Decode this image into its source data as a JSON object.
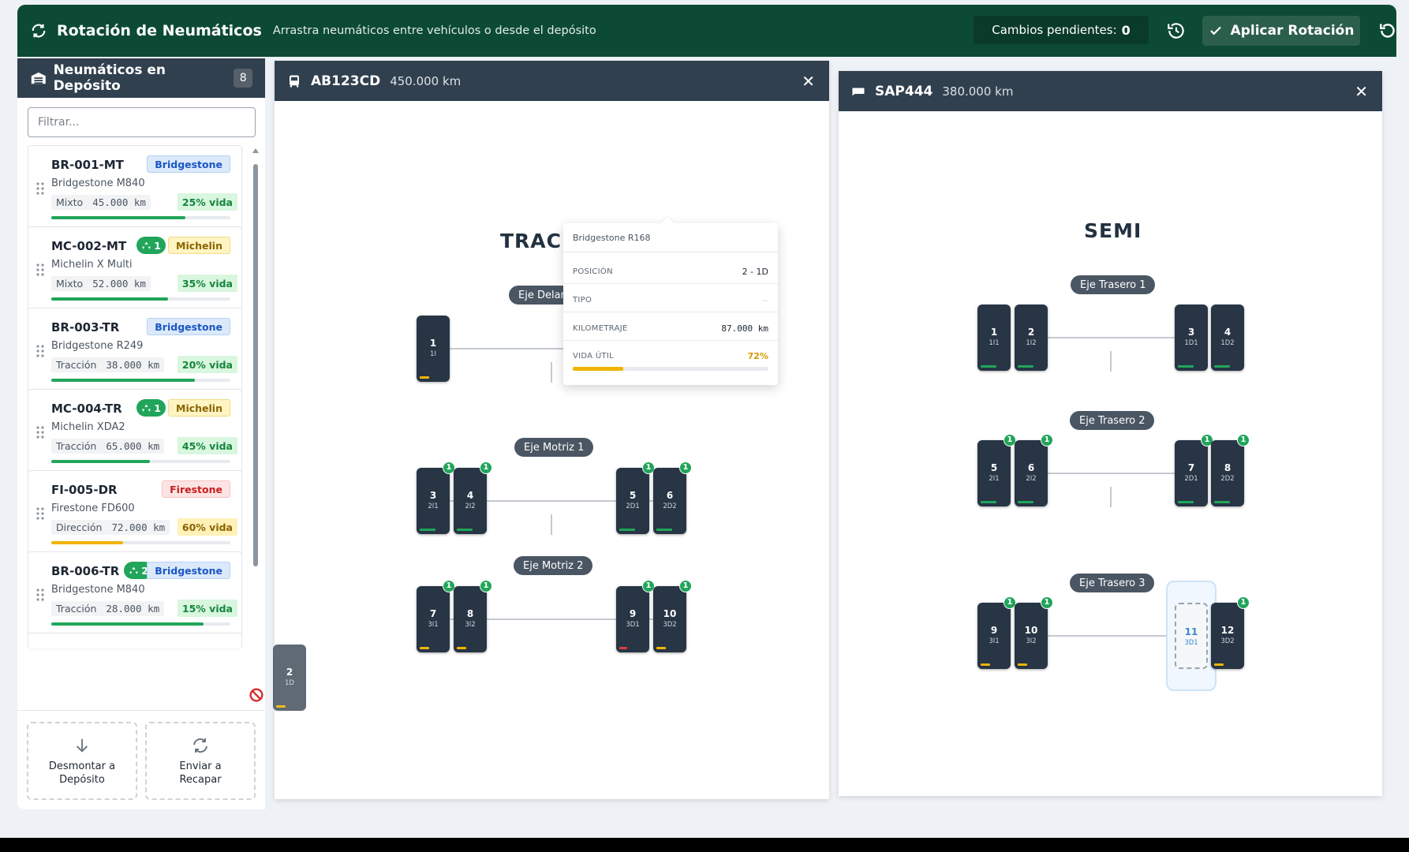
{
  "header": {
    "title": "Rotación de Neumáticos",
    "subtitle": "Arrastra neumáticos entre vehículos o desde el depósito",
    "pending_label": "Cambios pendientes:",
    "pending_count": "0",
    "apply_label": "Aplicar Rotación",
    "bg_color": "#0c4a35"
  },
  "sidebar": {
    "title": "Neumáticos en Depósito",
    "count": "8",
    "filter_placeholder": "Filtrar...",
    "cards": [
      {
        "code": "BR-001-MT",
        "brand": "Bridgestone",
        "model": "Bridgestone M840",
        "type": "Mixto",
        "km": "45.000 km",
        "life": "25% vida",
        "life_value": 0.75
      },
      {
        "code": "MC-002-MT",
        "recap": "1",
        "brand": "Michelin",
        "model": "Michelin X Multi",
        "type": "Mixto",
        "km": "52.000 km",
        "life": "35% vida",
        "life_value": 0.65
      },
      {
        "code": "BR-003-TR",
        "brand": "Bridgestone",
        "model": "Bridgestone R249",
        "type": "Tracción",
        "km": "38.000 km",
        "life": "20% vida",
        "life_value": 0.8
      },
      {
        "code": "MC-004-TR",
        "recap": "1",
        "brand": "Michelin",
        "model": "Michelin XDA2",
        "type": "Tracción",
        "km": "65.000 km",
        "life": "45% vida",
        "life_value": 0.55
      },
      {
        "code": "FI-005-DR",
        "brand": "Firestone",
        "model": "Firestone FD600",
        "type": "Dirección",
        "km": "72.000 km",
        "life": "60% vida",
        "life_value": 0.4
      },
      {
        "code": "BR-006-TR",
        "recap": "2",
        "brand": "Bridgestone",
        "model": "Bridgestone M840",
        "type": "Tracción",
        "km": "28.000 km",
        "life": "15% vida",
        "life_value": 0.85
      }
    ],
    "unmount_label_1": "Desmontar a",
    "unmount_label_2": "Depósito",
    "recap_label_1": "Enviar a",
    "recap_label_2": "Recapar"
  },
  "vehicle_a": {
    "plate": "AB123CD",
    "km": "450.000 km",
    "title": "TRAC",
    "axle_front": "Eje Delan",
    "axle_m1": "Eje Motriz 1",
    "axle_m2": "Eje Motriz 2",
    "tires": [
      {
        "n": "1",
        "p": "1I"
      },
      {
        "n": "3",
        "p": "2I1"
      },
      {
        "n": "4",
        "p": "2I2"
      },
      {
        "n": "5",
        "p": "2D1"
      },
      {
        "n": "6",
        "p": "2D2"
      },
      {
        "n": "7",
        "p": "3I1"
      },
      {
        "n": "8",
        "p": "3I2"
      },
      {
        "n": "9",
        "p": "3D1"
      },
      {
        "n": "10",
        "p": "3D2"
      }
    ],
    "badge": "1"
  },
  "dragged_tire": {
    "n": "2",
    "p": "1D"
  },
  "tooltip": {
    "model": "Bridgestone R168",
    "pos_label": "POSICIÓN",
    "pos_value": "2 - 1D",
    "type_label": "TIPO",
    "type_value": "--",
    "km_label": "KILOMETRAJE",
    "km_value": "87.000 km",
    "life_label": "VIDA ÚTIL",
    "life_value": "72%"
  },
  "vehicle_b": {
    "plate": "SAP444",
    "km": "380.000 km",
    "title": "SEMI",
    "axle_t1": "Eje Trasero 1",
    "axle_t2": "Eje Trasero 2",
    "axle_t3": "Eje Trasero 3",
    "tires": [
      {
        "n": "1",
        "p": "1I1"
      },
      {
        "n": "2",
        "p": "1I2"
      },
      {
        "n": "3",
        "p": "1D1"
      },
      {
        "n": "4",
        "p": "1D2"
      },
      {
        "n": "5",
        "p": "2I1"
      },
      {
        "n": "6",
        "p": "2I2"
      },
      {
        "n": "7",
        "p": "2D1"
      },
      {
        "n": "8",
        "p": "2D2"
      },
      {
        "n": "9",
        "p": "3I1"
      },
      {
        "n": "10",
        "p": "3I2"
      },
      {
        "n": "11",
        "p": "3D1"
      },
      {
        "n": "12",
        "p": "3D2"
      }
    ],
    "badge": "1"
  },
  "colors": {
    "green": "#21a55a",
    "amber": "#f0b400",
    "red": "#e03b3b",
    "dark": "#31404e"
  },
  "icons": [
    "rotate-icon",
    "warehouse-icon",
    "grip-icon",
    "recycle-icon",
    "arrow-down-icon",
    "refresh-icon",
    "history-icon",
    "check-icon",
    "undo-icon",
    "bus-icon",
    "truck-icon",
    "close-icon",
    "no-entry-icon"
  ]
}
